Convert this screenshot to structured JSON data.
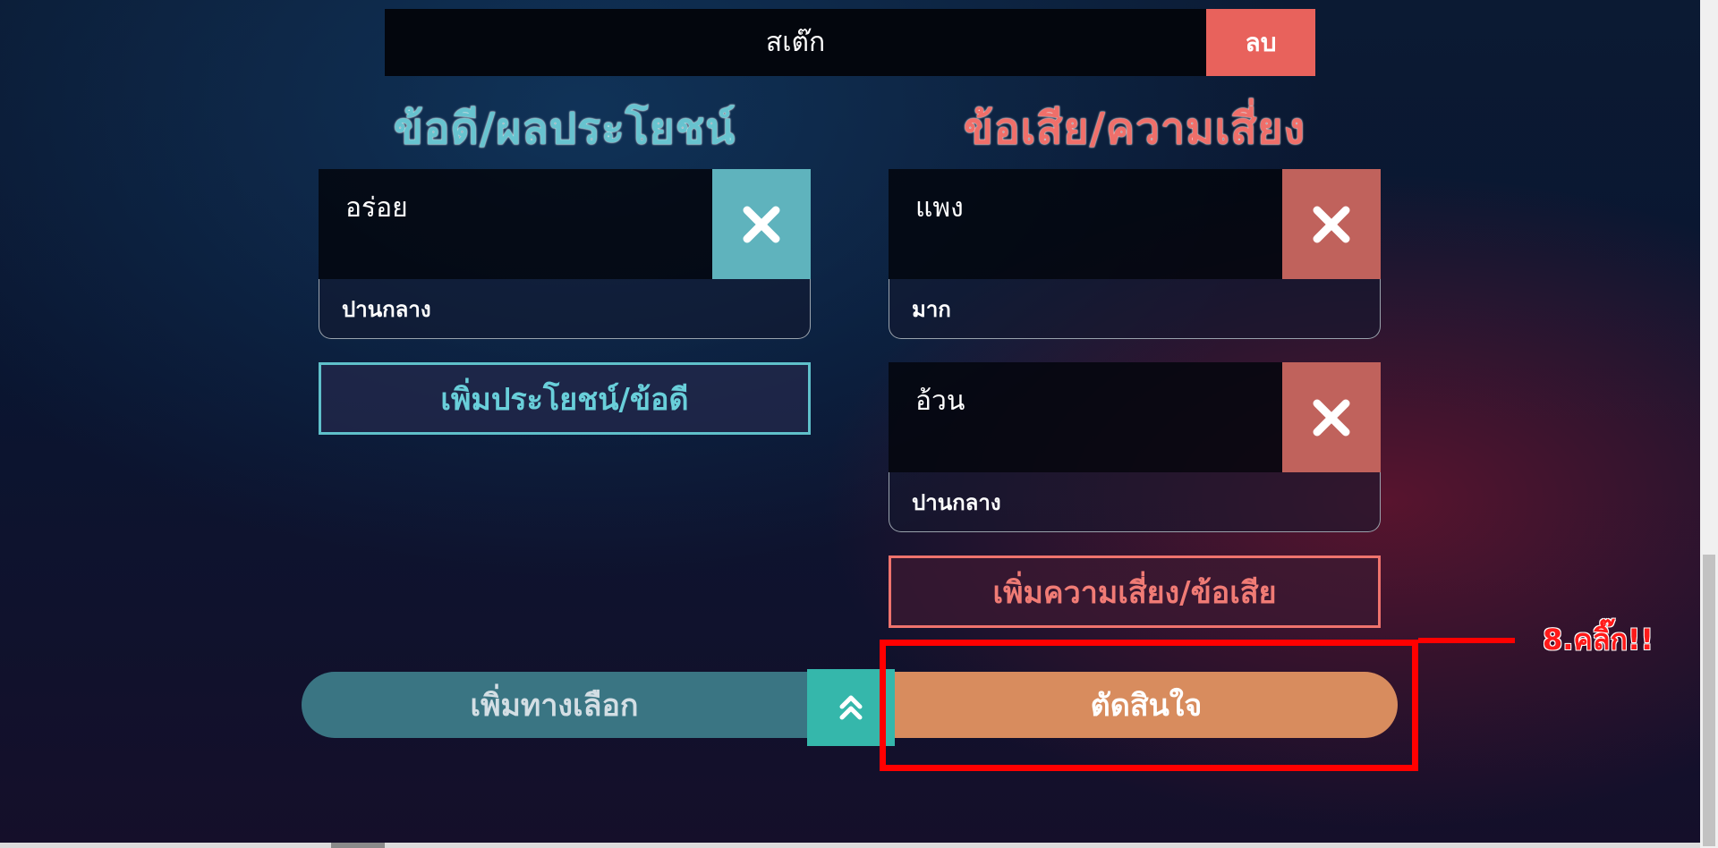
{
  "option": {
    "name": "สเต๊ก",
    "delete_label": "ลบ"
  },
  "pros": {
    "heading": "ข้อดี/ผลประโยชน์",
    "items": [
      {
        "text": "อร่อย",
        "level": "ปานกลาง"
      }
    ],
    "add_label": "เพิ่มประโยชน์/ข้อดี"
  },
  "cons": {
    "heading": "ข้อเสีย/ความเสี่ยง",
    "items": [
      {
        "text": "แพง",
        "level": "มาก"
      },
      {
        "text": "อ้วน",
        "level": "ปานกลาง"
      }
    ],
    "add_label": "เพิ่มความเสี่ยง/ข้อเสีย"
  },
  "footer": {
    "add_option_label": "เพิ่มทางเลือก",
    "toggle_icon": "double-chevron-up-icon",
    "decide_label": "ตัดสินใจ"
  },
  "annotation": {
    "text": "8.คลิ๊ก!!",
    "color": "#ff0000"
  },
  "colors": {
    "pro_accent": "#5fb3bd",
    "con_accent": "#e8625c",
    "decide_button": "#d88c5e",
    "add_option_button": "#3a7583",
    "toggle_button": "#35b7ab"
  }
}
